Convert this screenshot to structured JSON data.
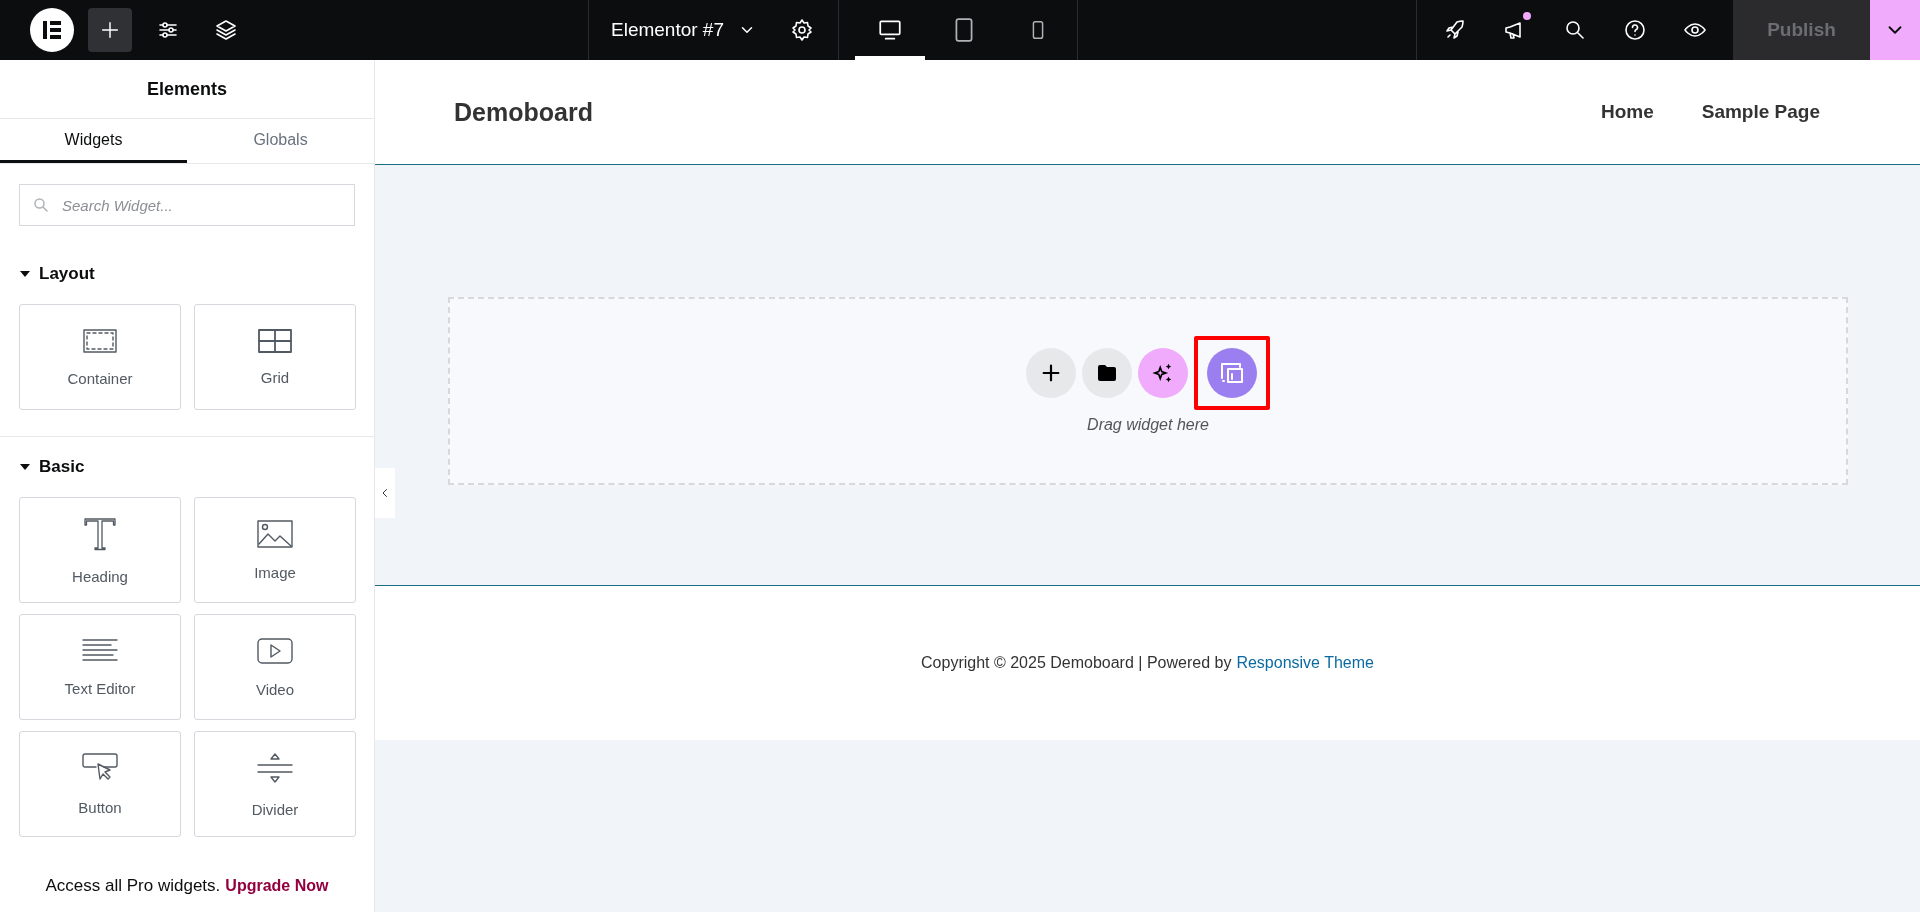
{
  "topbar": {
    "document_title": "Elementor #7",
    "devices": [
      {
        "kind": "desktop",
        "selected": true
      },
      {
        "kind": "tablet",
        "selected": false
      },
      {
        "kind": "mobile",
        "selected": false
      }
    ],
    "notification": true,
    "publish": {
      "label": "Publish",
      "disabled": true
    }
  },
  "panel": {
    "title": "Elements",
    "tabs": [
      {
        "label": "Widgets",
        "selected": true
      },
      {
        "label": "Globals",
        "selected": false
      }
    ],
    "search": {
      "placeholder": "Search Widget..."
    },
    "categories": [
      {
        "title": "Layout",
        "expanded": true,
        "widgets": [
          {
            "kind": "container",
            "label": "Container"
          },
          {
            "kind": "grid",
            "label": "Grid"
          }
        ]
      },
      {
        "title": "Basic",
        "expanded": true,
        "widgets": [
          {
            "kind": "heading",
            "label": "Heading"
          },
          {
            "kind": "image",
            "label": "Image"
          },
          {
            "kind": "text",
            "label": "Text Editor"
          },
          {
            "kind": "video",
            "label": "Video"
          },
          {
            "kind": "button",
            "label": "Button"
          },
          {
            "kind": "divider",
            "label": "Divider"
          }
        ]
      }
    ],
    "promo": {
      "text": "Access all Pro widgets.",
      "link": "Upgrade Now"
    }
  },
  "site": {
    "brand": "Demoboard",
    "nav": [
      "Home",
      "Sample Page"
    ],
    "drop_zone": {
      "hint": "Drag widget here",
      "actions": [
        {
          "kind": "add",
          "highlighted": false
        },
        {
          "kind": "template",
          "highlighted": false
        },
        {
          "kind": "ai",
          "highlighted": false
        },
        {
          "kind": "library",
          "highlighted": true
        }
      ]
    },
    "footer": {
      "text": "Copyright © 2025 Demoboard | Powered by",
      "link": "Responsive Theme"
    }
  }
}
